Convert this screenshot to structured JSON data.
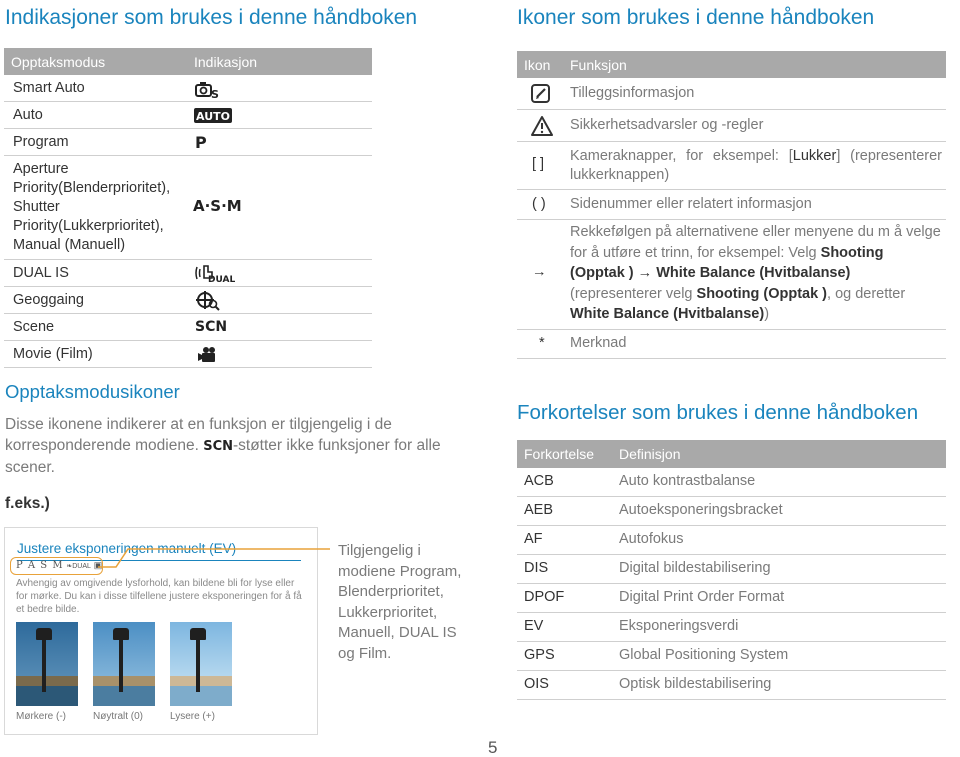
{
  "left": {
    "title": "Indikasjoner som brukes i denne håndboken",
    "table_headers": [
      "Opptaksmodus",
      "Indikasjon"
    ],
    "modes": [
      {
        "name": "Smart Auto",
        "icon": "SMART"
      },
      {
        "name": "Auto",
        "icon": "AUTO"
      },
      {
        "name": "Program",
        "icon": "P"
      },
      {
        "name": "Aperture Priority(Blenderprioritet), Shutter Priority(Lukkerprioritet), Manual (Manuell)",
        "icon": "A·S·M"
      },
      {
        "name": "DUAL IS",
        "icon": "DUAL"
      },
      {
        "name": "Geoggaing",
        "icon": "GEO"
      },
      {
        "name": "Scene",
        "icon": "SCN"
      },
      {
        "name": "Movie (Film)",
        "icon": "MOVIE"
      }
    ],
    "mode_icons_section": "Opptaksmodusikoner",
    "description_before": "Disse ikonene indikerer at en funksjon er tilgjengelig i de korresponderende modiene.",
    "scn_icon": "SCN",
    "description_after": "-støtter ikke funksjoner for alle scener.",
    "example_label": "f.eks.)",
    "example": {
      "title": "Justere eksponeringen manuelt (EV)",
      "modes_line": "P A S M",
      "text": "Avhengig av omgivende lysforhold, kan bildene bli for lyse eller for mørke. Du kan i disse tilfellene justere eksponeringen for å få et bedre bilde.",
      "captions": [
        "Mørkere (-)",
        "Nøytralt (0)",
        "Lysere (+)"
      ]
    },
    "callout": "Tilgjengelig i modiene Program, Blenderprioritet, Lukkerprioritet, Manuell, DUAL IS og Film."
  },
  "right": {
    "title": "Ikoner som brukes i denne håndboken",
    "icons_headers": [
      "Ikon",
      "Funksjon"
    ],
    "icons": [
      {
        "icon": "note-icon",
        "text": "Tilleggsinformasjon"
      },
      {
        "icon": "warning-icon",
        "text": "Sikkerhetsadvarsler og -regler"
      },
      {
        "symbol": "[ ]",
        "text_before": "Kameraknapper, for eksempel: [",
        "highlight": "Lukker",
        "text_after": "] (representerer lukkerknappen)"
      },
      {
        "symbol": "( )",
        "text": "Sidenummer eller relatert informasjon"
      },
      {
        "symbol": "→",
        "text_a": "Rekkefølgen på alternativene eller menyene du m å velge for å utføre et trinn, for eksempel: Velg ",
        "b1": "Shooting (Opptak )",
        "arrow": " → ",
        "b2": "White Balance (Hvitbalanse)",
        "text_b": " (representerer velg ",
        "b3": "Shooting (Opptak )",
        "text_c": ", og deretter ",
        "b4": "White Balance (Hvitbalanse)",
        "text_d": ")"
      },
      {
        "symbol": "*",
        "text": "Merknad"
      }
    ],
    "abbr_title": "Forkortelser som brukes i denne håndboken",
    "abbr_headers": [
      "Forkortelse",
      "Definisjon"
    ],
    "abbreviations": [
      {
        "abbr": "ACB",
        "def": "Auto kontrastbalanse"
      },
      {
        "abbr": "AEB",
        "def": "Autoeksponeringsbracket"
      },
      {
        "abbr": "AF",
        "def": "Autofokus"
      },
      {
        "abbr": "DIS",
        "def": "Digital bildestabilisering"
      },
      {
        "abbr": "DPOF",
        "def": "Digital Print Order Format"
      },
      {
        "abbr": "EV",
        "def": "Eksponeringsverdi"
      },
      {
        "abbr": "GPS",
        "def": "Global Positioning System"
      },
      {
        "abbr": "OIS",
        "def": "Optisk bildestabilisering"
      }
    ]
  },
  "page_number": "5",
  "colors": {
    "accent": "#1a84bd",
    "header_bg": "#a9a9a9",
    "highlight": "#e8a23a"
  }
}
